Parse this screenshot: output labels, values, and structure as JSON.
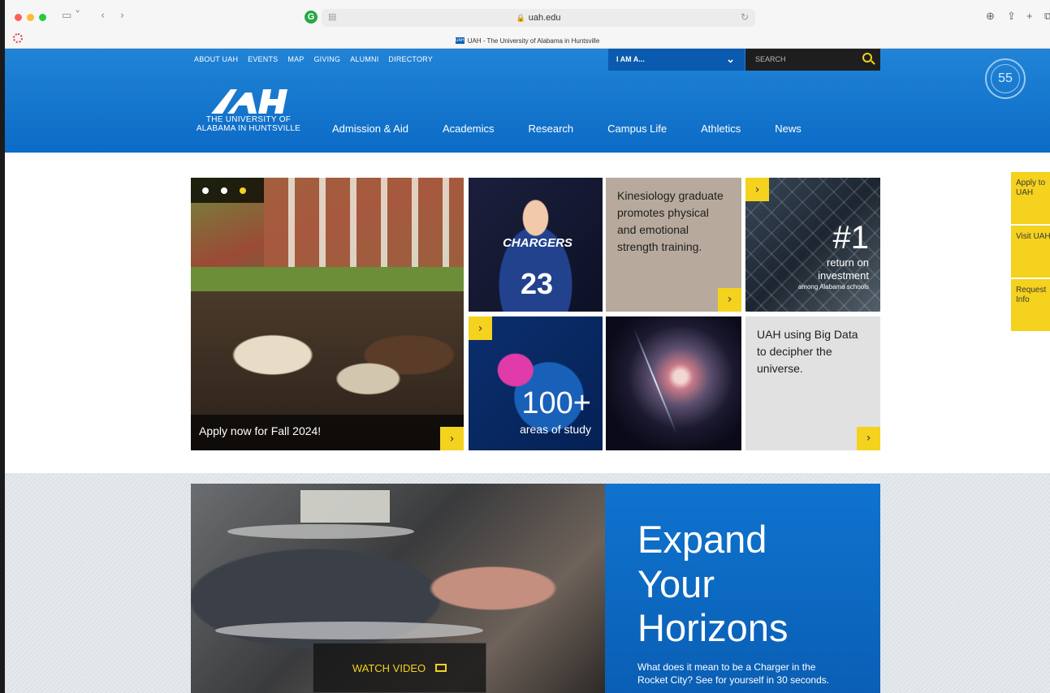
{
  "browser": {
    "url": "uah.edu",
    "tab_title": "UAH - The University of Alabama in Huntsville",
    "favicon_label": "UAH"
  },
  "header": {
    "utility_links": [
      "ABOUT UAH",
      "EVENTS",
      "MAP",
      "GIVING",
      "ALUMNI",
      "DIRECTORY"
    ],
    "iam_label": "I AM A...",
    "search_placeholder": "SEARCH",
    "logo_line1": "THE UNIVERSITY OF",
    "logo_line2": "ALABAMA IN HUNTSVILLE",
    "nav": [
      "Admission & Aid",
      "Academics",
      "Research",
      "Campus Life",
      "Athletics",
      "News"
    ],
    "seal_number": "55",
    "brand_blue": "#0c6bc6",
    "accent_yellow": "#f4d21d"
  },
  "side_tabs": [
    {
      "label": "Apply to UAH"
    },
    {
      "label": "Visit UAH"
    },
    {
      "label": "Request Info"
    }
  ],
  "hero": {
    "main_caption": "Apply now for Fall 2024!",
    "jersey_text": "CHARGERS",
    "jersey_number": "23",
    "kinesiology": "Kinesiology graduate promotes physical and emotional strength training.",
    "roi_big": "#1",
    "roi_line1": "return on",
    "roi_line2": "investment",
    "roi_small": "among Alabama schools",
    "study_big": "100+",
    "study_small": "areas of study",
    "bigdata": "UAH using Big Data to decipher the universe.",
    "arrow_glyph": "›"
  },
  "promo": {
    "watch_label": "WATCH VIDEO",
    "heading_1": "Expand",
    "heading_2": "Your",
    "heading_3": "Horizons",
    "body": "What does it mean to be a Charger in the Rocket City? See for yourself in 30 seconds."
  }
}
